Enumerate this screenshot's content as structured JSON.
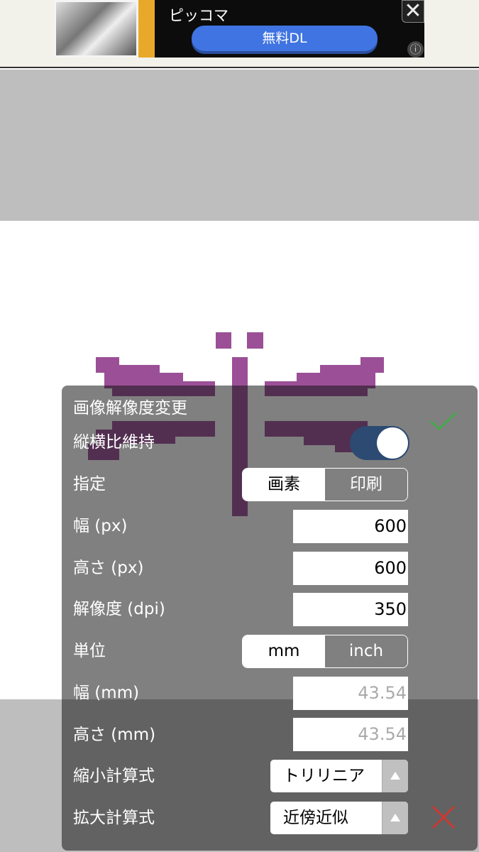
{
  "ad": {
    "title": "ピッコマ",
    "button_label": "無料DL",
    "close_icon": "close-icon",
    "info_icon": "info-icon"
  },
  "dialog": {
    "title": "画像解像度変更",
    "keep_aspect": {
      "label": "縦横比維持",
      "on": true
    },
    "mode": {
      "label": "指定",
      "options": [
        "画素",
        "印刷"
      ],
      "selected": "画素"
    },
    "width_px": {
      "label": "幅 (px)",
      "value": "600"
    },
    "height_px": {
      "label": "高さ (px)",
      "value": "600"
    },
    "resolution": {
      "label": "解像度 (dpi)",
      "value": "350"
    },
    "unit": {
      "label": "単位",
      "options": [
        "mm",
        "inch"
      ],
      "selected": "mm"
    },
    "width_mm": {
      "label": "幅 (mm)",
      "value": "43.54"
    },
    "height_mm": {
      "label": "高さ (mm)",
      "value": "43.54"
    },
    "downscale": {
      "label": "縮小計算式",
      "value": "トリリニア"
    },
    "upscale": {
      "label": "拡大計算式",
      "value": "近傍近似"
    },
    "colors": {
      "ok": "#3cb043",
      "cancel": "#d9342b",
      "toggle": "#2c4a72",
      "art": "#9b4f96"
    }
  }
}
